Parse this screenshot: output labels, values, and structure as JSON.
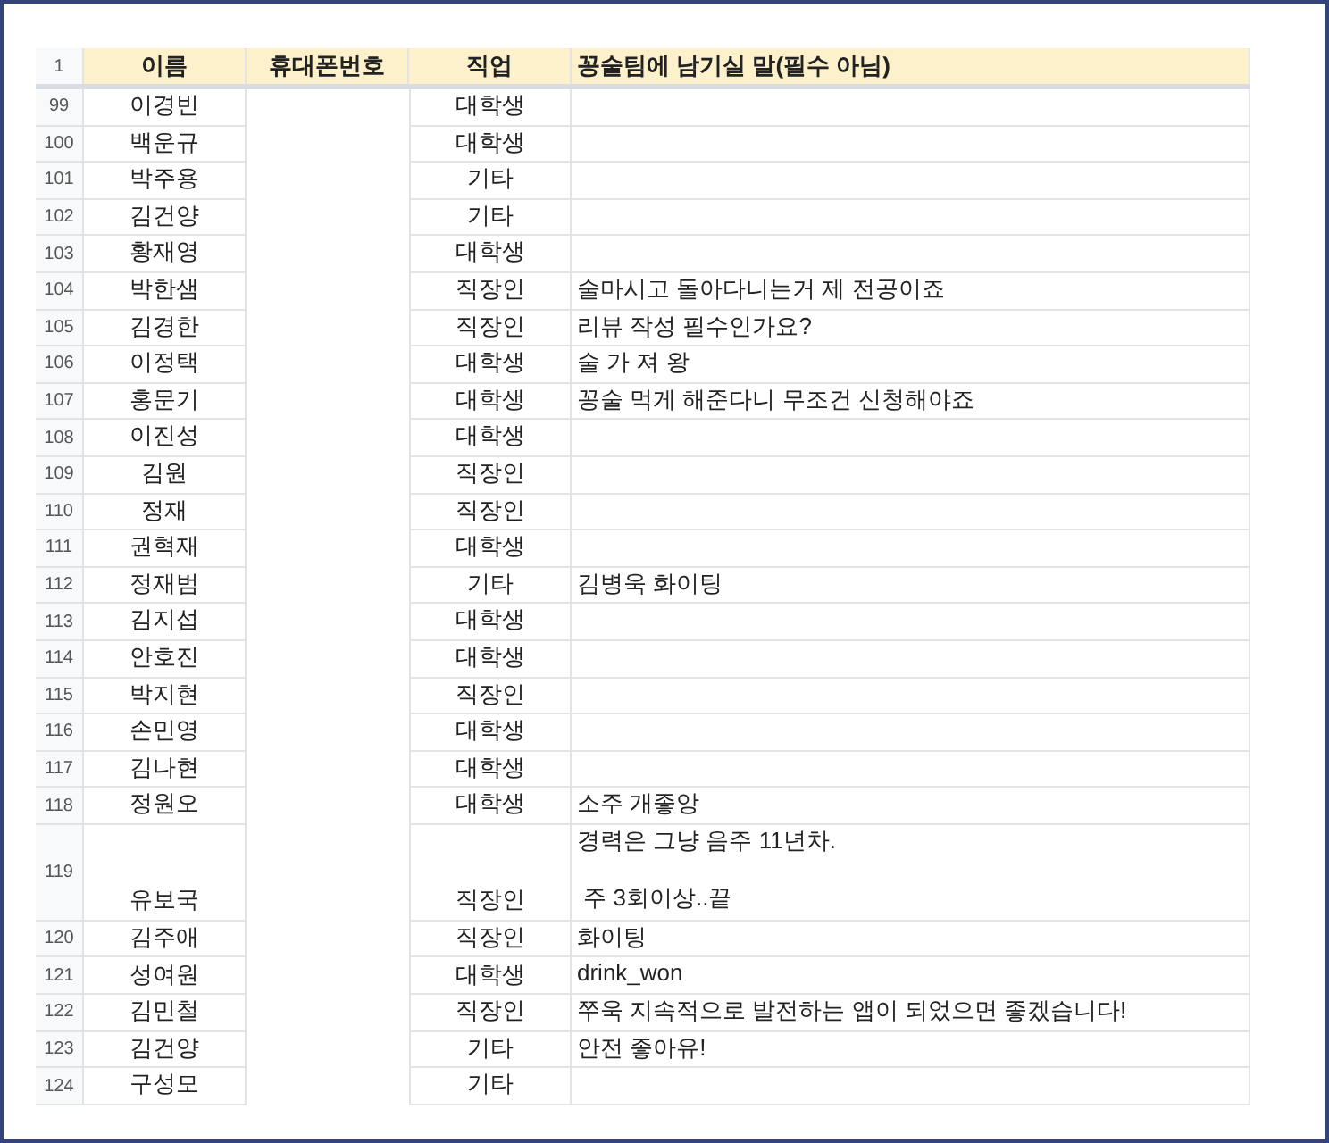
{
  "header": {
    "row_number": "1",
    "columns": [
      "이름",
      "휴대폰번호",
      "직업",
      "꽁술팀에 남기실 말(필수 아님)"
    ]
  },
  "rows": [
    {
      "number": "99",
      "name": "이경빈",
      "job": "대학생",
      "message": ""
    },
    {
      "number": "100",
      "name": "백운규",
      "job": "대학생",
      "message": ""
    },
    {
      "number": "101",
      "name": "박주용",
      "job": "기타",
      "message": ""
    },
    {
      "number": "102",
      "name": "김건양",
      "job": "기타",
      "message": ""
    },
    {
      "number": "103",
      "name": "황재영",
      "job": "대학생",
      "message": ""
    },
    {
      "number": "104",
      "name": "박한샘",
      "job": "직장인",
      "message": "술마시고 돌아다니는거 제 전공이죠"
    },
    {
      "number": "105",
      "name": "김경한",
      "job": "직장인",
      "message": "리뷰 작성 필수인가요?"
    },
    {
      "number": "106",
      "name": "이정택",
      "job": "대학생",
      "message": "술 가 져 왕"
    },
    {
      "number": "107",
      "name": "홍문기",
      "job": "대학생",
      "message": "꽁술 먹게 해준다니 무조건 신청해야죠"
    },
    {
      "number": "108",
      "name": "이진성",
      "job": "대학생",
      "message": ""
    },
    {
      "number": "109",
      "name": "김원",
      "job": "직장인",
      "message": ""
    },
    {
      "number": "110",
      "name": "정재",
      "job": "직장인",
      "message": ""
    },
    {
      "number": "111",
      "name": "권혁재",
      "job": "대학생",
      "message": ""
    },
    {
      "number": "112",
      "name": "정재범",
      "job": "기타",
      "message": "김병욱 화이팅"
    },
    {
      "number": "113",
      "name": "김지섭",
      "job": "대학생",
      "message": ""
    },
    {
      "number": "114",
      "name": "안호진",
      "job": "대학생",
      "message": ""
    },
    {
      "number": "115",
      "name": "박지현",
      "job": "직장인",
      "message": ""
    },
    {
      "number": "116",
      "name": "손민영",
      "job": "대학생",
      "message": ""
    },
    {
      "number": "117",
      "name": "김나현",
      "job": "대학생",
      "message": ""
    },
    {
      "number": "118",
      "name": "정원오",
      "job": "대학생",
      "message": "소주 개좋앙"
    },
    {
      "number": "119",
      "name": "유보국",
      "job": "직장인",
      "message": "경력은 그냥 음주 11년차.\n\n 주 3회이상..끝"
    },
    {
      "number": "120",
      "name": "김주애",
      "job": "직장인",
      "message": "화이팅"
    },
    {
      "number": "121",
      "name": "성여원",
      "job": "대학생",
      "message": "drink_won"
    },
    {
      "number": "122",
      "name": "김민철",
      "job": "직장인",
      "message": "쭈욱 지속적으로 발전하는 앱이 되었으면 좋겠습니다!"
    },
    {
      "number": "123",
      "name": "김건양",
      "job": "기타",
      "message": "안전 좋아유!"
    },
    {
      "number": "124",
      "name": "구성모",
      "job": "기타",
      "message": ""
    }
  ]
}
